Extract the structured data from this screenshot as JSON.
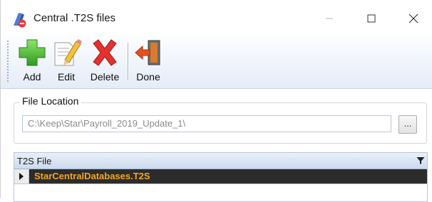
{
  "window": {
    "title": "Central .T2S files",
    "icon": "app-icon",
    "controls": [
      "minimize-icon",
      "maximize-icon",
      "close-icon"
    ]
  },
  "toolbar": {
    "buttons": [
      {
        "label": "Add",
        "icon": "green-plus-icon"
      },
      {
        "label": "Edit",
        "icon": "pencil-paper-icon"
      },
      {
        "label": "Delete",
        "icon": "red-x-icon"
      },
      {
        "label": "Done",
        "icon": "exit-door-icon"
      }
    ]
  },
  "file_location": {
    "legend": "File Location",
    "path": "C:\\Keep\\Star\\Payroll_2019_Update_1\\",
    "browse_label": "..."
  },
  "grid": {
    "column": "T2S File",
    "rows": [
      "StarCentralDatabases.T2S"
    ],
    "colors": {
      "selected_row_bg": "#2c2c2c",
      "selected_row_text": "#f5a623"
    }
  }
}
